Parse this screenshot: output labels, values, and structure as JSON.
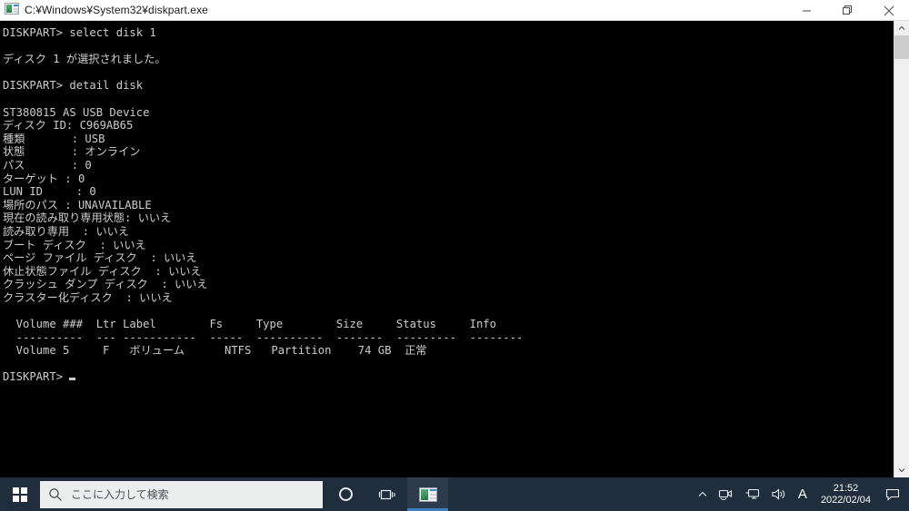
{
  "window": {
    "title": "C:¥Windows¥System32¥diskpart.exe",
    "icon": "console-icon",
    "controls": {
      "minimize": "minimize-button",
      "restore": "restore-button",
      "close": "close-button"
    }
  },
  "console": {
    "foreground": "#cccccc",
    "background": "#000000",
    "lines": [
      "DISKPART> select disk 1",
      "",
      "ディスク 1 が選択されました。",
      "",
      "DISKPART> detail disk",
      "",
      "ST380815 AS USB Device",
      "ディスク ID: C969AB65",
      "種類       : USB",
      "状態       : オンライン",
      "パス       : 0",
      "ターゲット : 0",
      "LUN ID     : 0",
      "場所のパス : UNAVAILABLE",
      "現在の読み取り専用状態: いいえ",
      "読み取り専用  : いいえ",
      "ブート ディスク  : いいえ",
      "ページ ファイル ディスク  : いいえ",
      "休止状態ファイル ディスク  : いいえ",
      "クラッシュ ダンプ ディスク  : いいえ",
      "クラスター化ディスク  : いいえ",
      "",
      "  Volume ###  Ltr Label        Fs     Type        Size     Status     Info",
      "  ----------  --- -----------  -----  ----------  -------  ---------  --------",
      "  Volume 5     F   ボリューム      NTFS   Partition    74 GB  正常",
      "",
      "DISKPART> "
    ],
    "prompt": "DISKPART>",
    "cursor": "block-cursor",
    "volume_table": {
      "headers": [
        "Volume ###",
        "Ltr",
        "Label",
        "Fs",
        "Type",
        "Size",
        "Status",
        "Info"
      ],
      "rows": [
        [
          "Volume 5",
          "F",
          "ボリューム",
          "NTFS",
          "Partition",
          "74 GB",
          "正常",
          ""
        ]
      ]
    },
    "disk_detail": {
      "model": "ST380815 AS USB Device",
      "disk_id_label": "ディスク ID:",
      "disk_id": "C969AB65",
      "properties": [
        {
          "label": "種類",
          "value": "USB"
        },
        {
          "label": "状態",
          "value": "オンライン"
        },
        {
          "label": "パス",
          "value": "0"
        },
        {
          "label": "ターゲット",
          "value": "0"
        },
        {
          "label": "LUN ID",
          "value": "0"
        },
        {
          "label": "場所のパス",
          "value": "UNAVAILABLE"
        },
        {
          "label": "現在の読み取り専用状態",
          "value": "いいえ"
        },
        {
          "label": "読み取り専用",
          "value": "いいえ"
        },
        {
          "label": "ブート ディスク",
          "value": "いいえ"
        },
        {
          "label": "ページ ファイル ディスク",
          "value": "いいえ"
        },
        {
          "label": "休止状態ファイル ディスク",
          "value": "いいえ"
        },
        {
          "label": "クラッシュ ダンプ ディスク",
          "value": "いいえ"
        },
        {
          "label": "クラスター化ディスク",
          "value": "いいえ"
        }
      ]
    },
    "commands": [
      "select disk 1",
      "detail disk"
    ],
    "messages": [
      "ディスク 1 が選択されました。"
    ]
  },
  "scrollbar": {
    "up_arrow": "scroll-up-arrow",
    "down_arrow": "scroll-down-arrow",
    "thumb": "scroll-thumb"
  },
  "taskbar": {
    "background": "#1f2d3d",
    "start": "start-button",
    "search": {
      "placeholder": "ここに入力して検索",
      "icon": "search-icon"
    },
    "cortana": "cortana-button",
    "task_view": "task-view-button",
    "apps": [
      {
        "name": "diskpart",
        "icon": "console-icon",
        "active": true
      }
    ],
    "tray": {
      "show_hidden": "chevron-up-icon",
      "icons": [
        "camera-icon",
        "network-icon",
        "volume-icon"
      ],
      "ime": "A",
      "clock": {
        "time": "21:52",
        "date": "2022/02/04"
      },
      "notifications": "notification-icon"
    }
  }
}
